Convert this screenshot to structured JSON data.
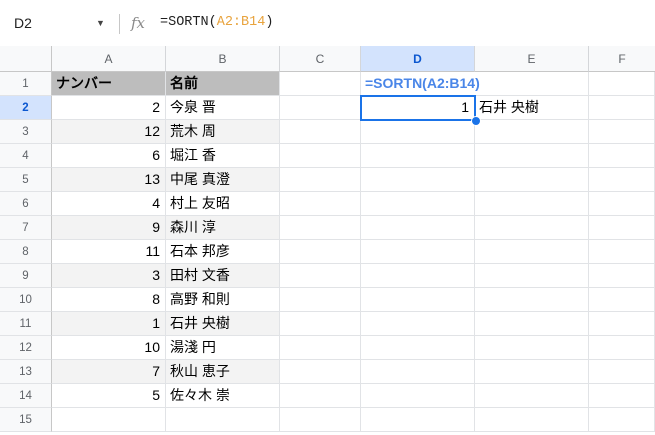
{
  "formula_bar": {
    "cell_ref": "D2",
    "fx_label": "fx",
    "formula_prefix": "=SORTN(",
    "formula_ref": "A2:B14",
    "formula_suffix": ")"
  },
  "columns": [
    "A",
    "B",
    "C",
    "D",
    "E",
    "F"
  ],
  "rows": [
    "1",
    "2",
    "3",
    "4",
    "5",
    "6",
    "7",
    "8",
    "9",
    "10",
    "11",
    "12",
    "13",
    "14",
    "15"
  ],
  "headers": {
    "a1": "ナンバー",
    "b1": "名前"
  },
  "data": [
    {
      "num": "2",
      "name": "今泉 晋"
    },
    {
      "num": "12",
      "name": "荒木 周"
    },
    {
      "num": "6",
      "name": "堀江 香"
    },
    {
      "num": "13",
      "name": "中尾 真澄"
    },
    {
      "num": "4",
      "name": "村上 友昭"
    },
    {
      "num": "9",
      "name": "森川 淳"
    },
    {
      "num": "11",
      "name": "石本 邦彦"
    },
    {
      "num": "3",
      "name": "田村 文香"
    },
    {
      "num": "8",
      "name": "高野 和則"
    },
    {
      "num": "1",
      "name": "石井 央樹"
    },
    {
      "num": "10",
      "name": "湯淺 円"
    },
    {
      "num": "7",
      "name": "秋山 恵子"
    },
    {
      "num": "5",
      "name": "佐々木 崇"
    }
  ],
  "d1_formula_text": "=SORTN(A2:B14)",
  "result": {
    "d2": "1",
    "e2": "石井 央樹"
  }
}
